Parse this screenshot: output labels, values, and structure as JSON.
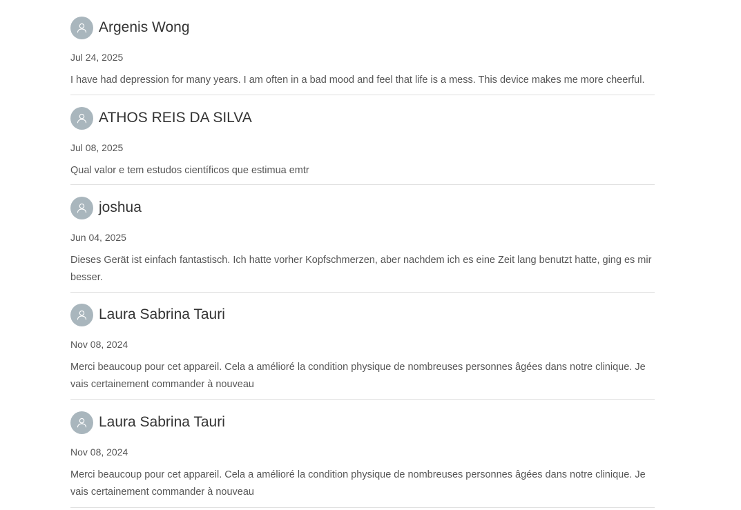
{
  "reviews": [
    {
      "name": "Argenis Wong",
      "date": "Jul 24, 2025",
      "text": "I have had depression for many years. I am often in a bad mood and feel that life is a mess. This device makes me more cheerful.",
      "avatar_icon": "user-avatar-icon"
    },
    {
      "name": "ATHOS REIS DA SILVA",
      "date": "Jul 08, 2025",
      "text": "Qual valor e tem estudos científicos que estimua emtr",
      "avatar_icon": "user-avatar-icon"
    },
    {
      "name": "joshua",
      "date": "Jun 04, 2025",
      "text": "Dieses Gerät ist einfach fantastisch. Ich hatte vorher Kopfschmerzen, aber nachdem ich es eine Zeit lang benutzt hatte, ging es mir besser.",
      "avatar_icon": "user-avatar-icon"
    },
    {
      "name": "Laura Sabrina Tauri",
      "date": "Nov 08, 2024",
      "text": "Merci beaucoup pour cet appareil. Cela a amélioré la condition physique de nombreuses personnes âgées dans notre clinique. Je vais certainement commander à nouveau",
      "avatar_icon": "user-avatar-icon"
    },
    {
      "name": "Laura Sabrina Tauri",
      "date": "Nov 08, 2024",
      "text": "Merci beaucoup pour cet appareil. Cela a amélioré la condition physique de nombreuses personnes âgées dans notre clinique. Je vais certainement commander à nouveau",
      "avatar_icon": "user-avatar-icon"
    }
  ],
  "colors": {
    "avatar_bg": "#a9b6bd",
    "divider": "#e0e0e0",
    "name_text": "#333333",
    "body_text": "#555555"
  }
}
